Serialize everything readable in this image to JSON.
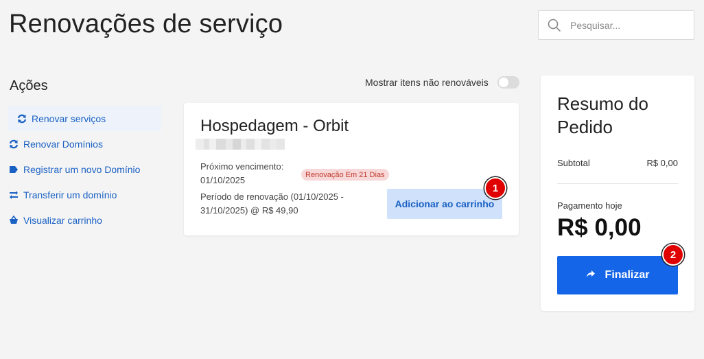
{
  "page": {
    "title": "Renovações de serviço"
  },
  "search": {
    "placeholder": "Pesquisar..."
  },
  "sidebar": {
    "title": "Ações",
    "items": [
      {
        "label": "Renovar serviços",
        "icon": "sync-icon",
        "active": true
      },
      {
        "label": "Renovar Domínios",
        "icon": "sync-icon"
      },
      {
        "label": "Registrar um novo Domínio",
        "icon": "tag-icon"
      },
      {
        "label": "Transferir um domínio",
        "icon": "transfer-icon"
      },
      {
        "label": "Visualizar carrinho",
        "icon": "basket-icon"
      }
    ]
  },
  "filter": {
    "label": "Mostrar itens não renováveis",
    "enabled": false
  },
  "service": {
    "name": "Hospedagem - Orbit",
    "next_due_label": "Próximo vencimento:",
    "next_due_date": "01/10/2025",
    "badge": "Renovação Em 21 Dias",
    "period_line1": "Período de renovação (01/10/2025 -",
    "period_line2": "31/10/2025) @ R$ 49,90",
    "add_button": "Adicionar ao carrinho",
    "step_badge": "1"
  },
  "summary": {
    "title": "Resumo do Pedido",
    "subtotal_label": "Subtotal",
    "subtotal_value": "R$ 0,00",
    "pay_today_label": "Pagamento hoje",
    "pay_today_value": "R$ 0,00",
    "checkout_button": "Finalizar",
    "step_badge": "2"
  },
  "colors": {
    "accent": "#1565e8",
    "link": "#1a61c4",
    "badge_red": "#e00000"
  }
}
